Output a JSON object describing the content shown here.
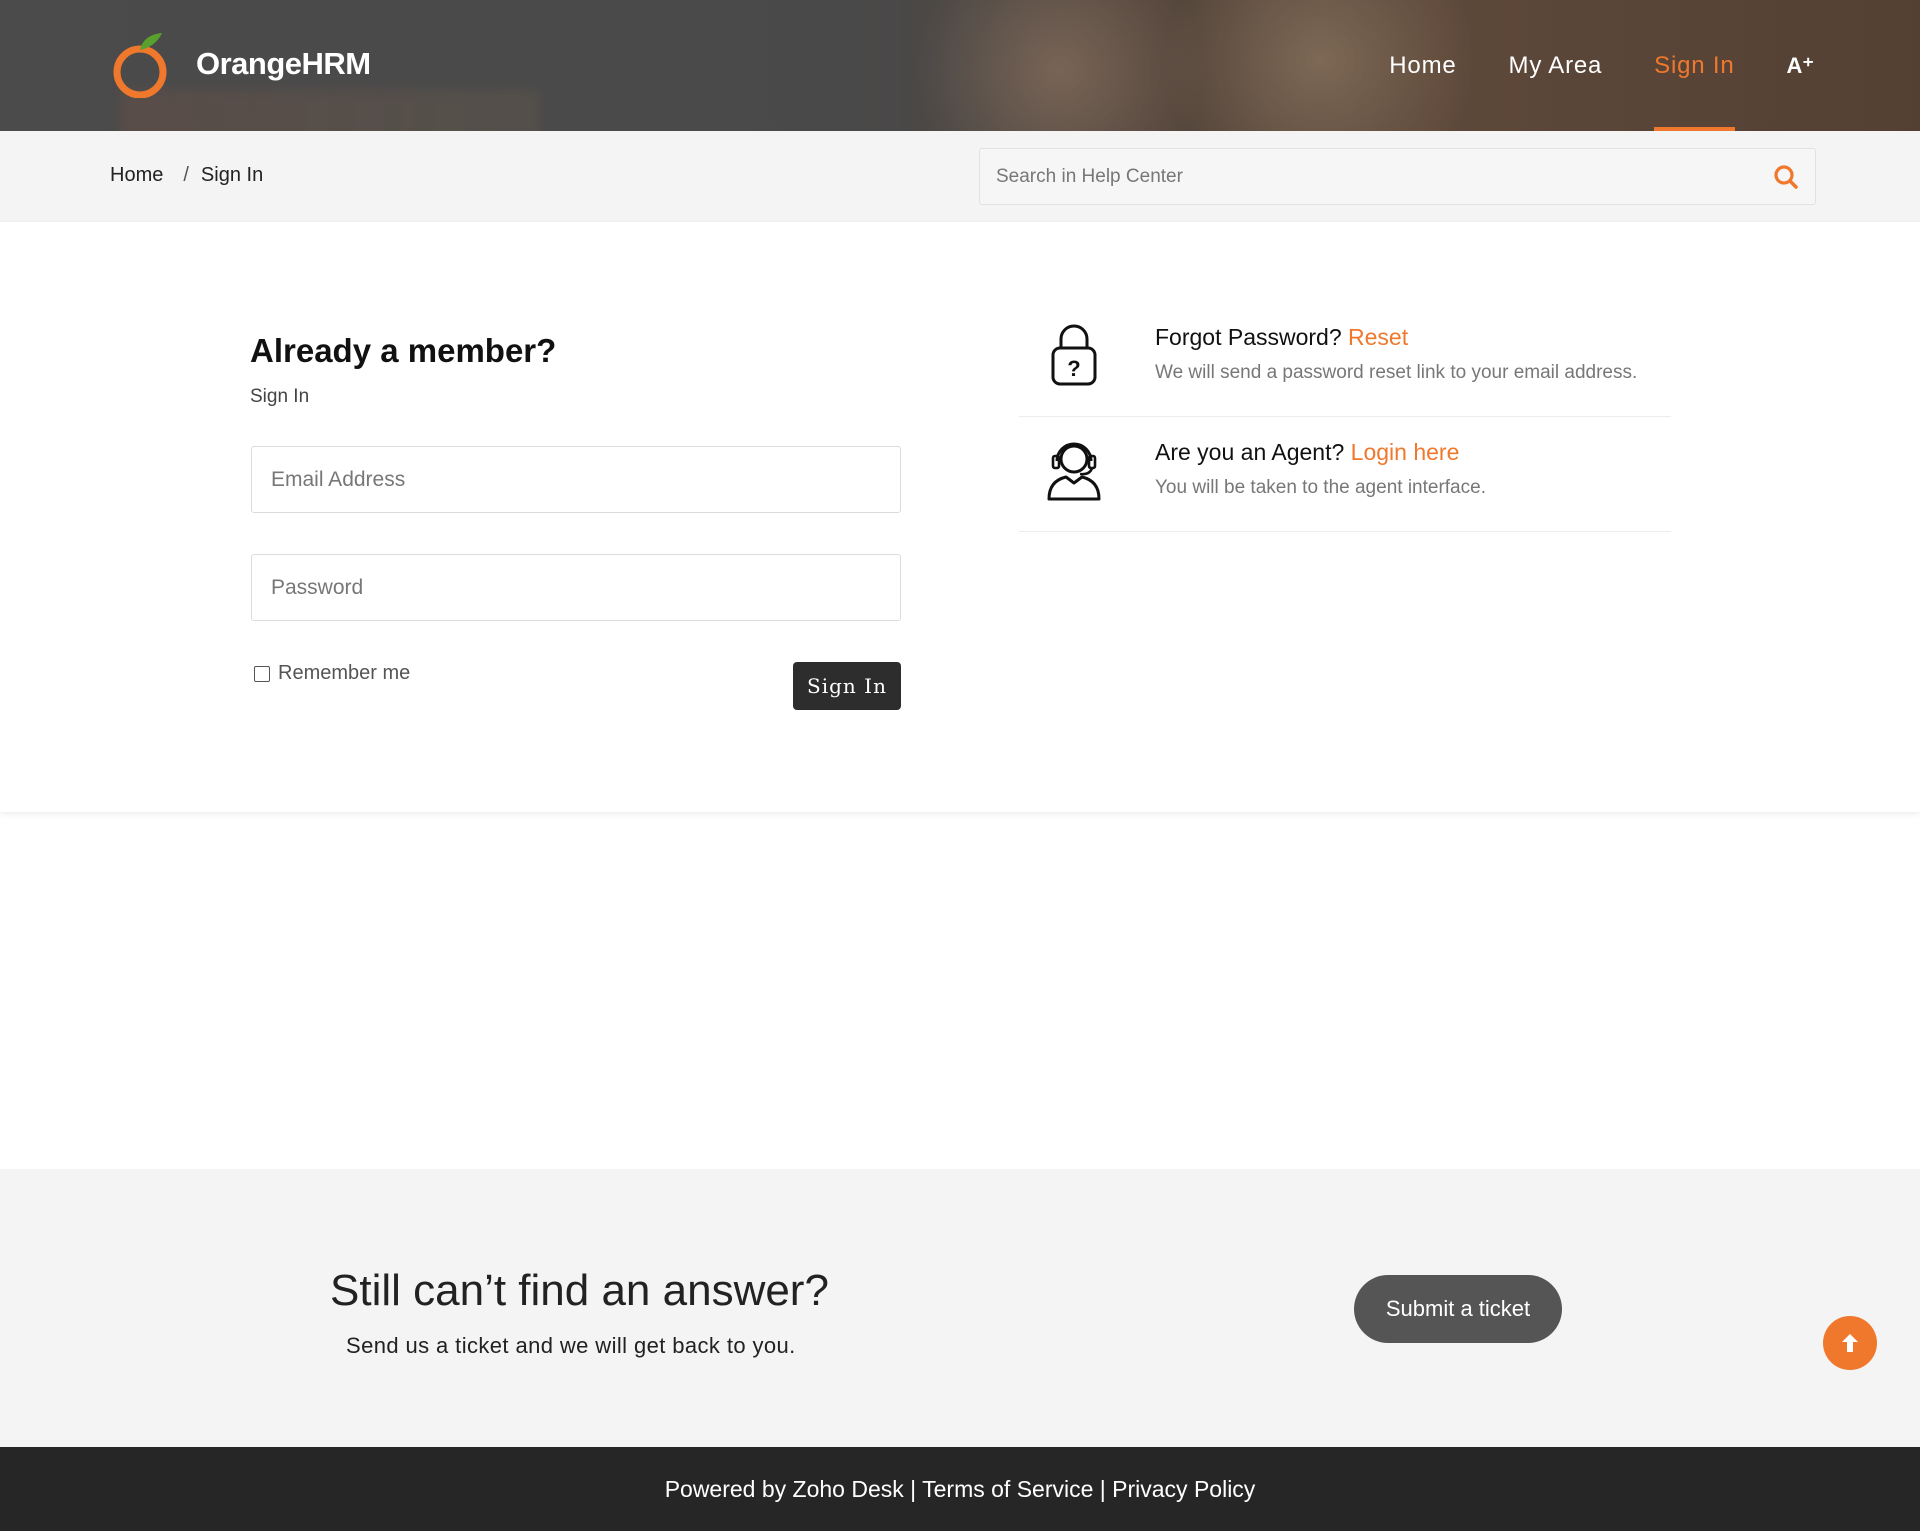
{
  "header": {
    "brand": "OrangeHRM",
    "nav": [
      {
        "label": "Home"
      },
      {
        "label": "My Area"
      },
      {
        "label": "Sign In",
        "active": true
      }
    ],
    "font_size_button": "A⁺"
  },
  "breadcrumb": {
    "items": [
      "Home",
      "Sign In"
    ],
    "separator": "/"
  },
  "search": {
    "placeholder": "Search in Help Center"
  },
  "signin": {
    "title": "Already a member?",
    "subtitle": "Sign In",
    "email_placeholder": "Email Address",
    "password_placeholder": "Password",
    "remember_label": "Remember me",
    "remember_checked": false,
    "button_label": "Sign In"
  },
  "help": {
    "forgot": {
      "question": "Forgot Password?",
      "link": "Reset",
      "description": "We will send a password reset link to your email address."
    },
    "agent": {
      "question": "Are you an Agent?",
      "link": "Login here",
      "description": "You will be taken to the agent interface."
    }
  },
  "cta": {
    "title": "Still can’t find an answer?",
    "subtitle": "Send us a ticket and we will get back to you.",
    "button_label": "Submit a ticket"
  },
  "footer": {
    "powered": "Powered by Zoho Desk",
    "sep": "|",
    "terms": "Terms of Service",
    "privacy": "Privacy Policy"
  },
  "colors": {
    "accent": "#f0782d",
    "dark_button": "#2d2d2d",
    "footer_bg": "#262626"
  }
}
